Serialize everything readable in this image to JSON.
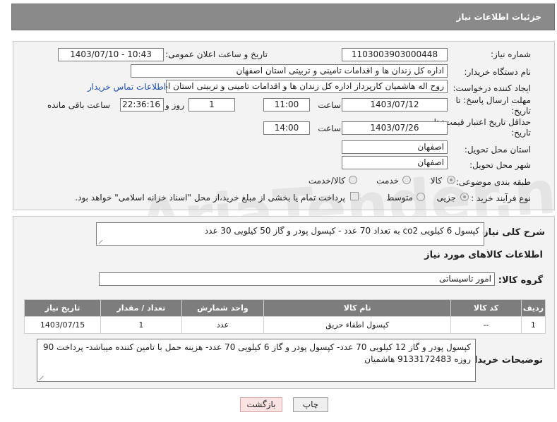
{
  "header": {
    "title": "جزئیات اطلاعات نیاز"
  },
  "labels": {
    "need_number": "شماره نیاز:",
    "announce_datetime": "تاریخ و ساعت اعلان عمومی:",
    "buyer_org": "نام دستگاه خریدار:",
    "requester": "ایجاد کننده درخواست:",
    "reply_deadline_1": "مهلت ارسال پاسخ: تا",
    "reply_deadline_2": "تاریخ:",
    "time": "ساعت",
    "day_and": "روز و",
    "remaining": "ساعت باقی مانده",
    "price_validity_1": "حداقل تاریخ اعتبار قیمت: تا",
    "price_validity_2": "تاریخ:",
    "delivery_province": "استان محل تحویل:",
    "delivery_city": "شهر محل تحویل:",
    "category": "طبقه بندی موضوعی:",
    "process_type": "نوع فرآیند خرید :",
    "need_summary": "شرح کلی نیاز:",
    "goods_info": "اطلاعات کالاهای مورد نیاز",
    "goods_group": "گروه کالا:",
    "buyer_notes": "توضیحات خریدار:"
  },
  "values": {
    "need_number": "1103003903000448",
    "announce_datetime": "1403/07/10 - 10:43",
    "buyer_org": "اداره کل زندان ها و اقدامات تامینی و تربیتی استان اصفهان",
    "requester": "روح اله هاشمیان کارپرداز اداره کل زندان ها و اقدامات تامینی و تربیتی استان اصفهان",
    "contact_link": "اطلاعات تماس خریدار",
    "reply_date": "1403/07/12",
    "reply_time": "11:00",
    "reply_days": "1",
    "reply_remaining": "22:36:16",
    "price_date": "1403/07/26",
    "price_time": "14:00",
    "delivery_province": "اصفهان",
    "delivery_city": "اصفهان",
    "need_summary": "کپسول 6 کیلویی co2 به تعداد 70 عدد - کپسول پودر و گاز 50 کیلویی 30 عدد",
    "goods_group": "امور تاسیساتی",
    "buyer_notes": "کپسول پودر و گاز 12 کیلویی 70 عدد- کپسول پودر و گاز 6 کیلویی 70 عدد- هزینه حمل با تامین کننده میباشد- پرداخت 90 روزه 9133172483 هاشمیان"
  },
  "category_options": [
    "کالا",
    "خدمت",
    "کالا/خدمت"
  ],
  "category_selected": "کالا",
  "process_options": [
    "جزیی",
    "متوسط"
  ],
  "process_selected": "جزیی",
  "treasury_note": "پرداخت تمام یا بخشی از مبلغ خرید،از محل \"اسناد خزانه اسلامی\" خواهد بود.",
  "table": {
    "headers": [
      "ردیف",
      "کد کالا",
      "نام کالا",
      "واحد شمارش",
      "تعداد / مقدار",
      "تاریخ نیاز"
    ],
    "rows": [
      [
        "1",
        "--",
        "کپسول اطفاء حریق",
        "عدد",
        "1",
        "1403/07/15"
      ]
    ]
  },
  "buttons": {
    "print": "چاپ",
    "back": "بازگشت"
  },
  "watermark": {
    "brand": "AriaTender.neT"
  }
}
